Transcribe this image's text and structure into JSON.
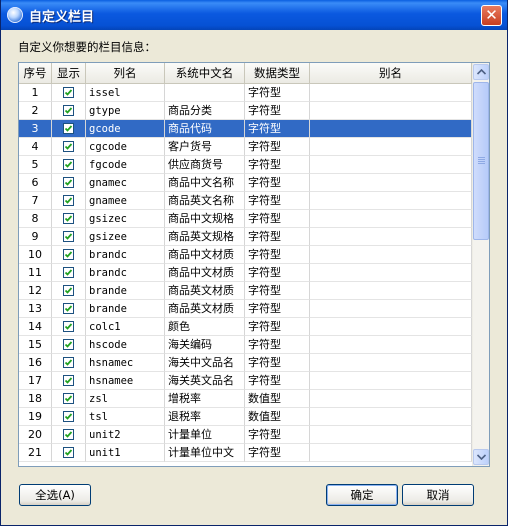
{
  "window": {
    "title": "自定义栏目",
    "close_glyph": "✕"
  },
  "prompt": "自定义你想要的栏目信息：",
  "table": {
    "headers": [
      "序号",
      "显示",
      "列名",
      "系统中文名",
      "数据类型",
      "别名"
    ],
    "selected_index": 2,
    "rows": [
      {
        "num": "1",
        "checked": true,
        "column": "issel",
        "cn_name": "",
        "dtype": "字符型",
        "alias": ""
      },
      {
        "num": "2",
        "checked": true,
        "column": "gtype",
        "cn_name": "商品分类",
        "dtype": "字符型",
        "alias": ""
      },
      {
        "num": "3",
        "checked": true,
        "column": "gcode",
        "cn_name": "商品代码",
        "dtype": "字符型",
        "alias": ""
      },
      {
        "num": "4",
        "checked": true,
        "column": "cgcode",
        "cn_name": "客户货号",
        "dtype": "字符型",
        "alias": ""
      },
      {
        "num": "5",
        "checked": true,
        "column": "fgcode",
        "cn_name": "供应商货号",
        "dtype": "字符型",
        "alias": ""
      },
      {
        "num": "6",
        "checked": true,
        "column": "gnamec",
        "cn_name": "商品中文名称",
        "dtype": "字符型",
        "alias": ""
      },
      {
        "num": "7",
        "checked": true,
        "column": "gnamee",
        "cn_name": "商品英文名称",
        "dtype": "字符型",
        "alias": ""
      },
      {
        "num": "8",
        "checked": true,
        "column": "gsizec",
        "cn_name": "商品中文规格",
        "dtype": "字符型",
        "alias": ""
      },
      {
        "num": "9",
        "checked": true,
        "column": "gsizee",
        "cn_name": "商品英文规格",
        "dtype": "字符型",
        "alias": ""
      },
      {
        "num": "10",
        "checked": true,
        "column": "brandc",
        "cn_name": "商品中文材质",
        "dtype": "字符型",
        "alias": ""
      },
      {
        "num": "11",
        "checked": true,
        "column": "brandc",
        "cn_name": "商品中文材质",
        "dtype": "字符型",
        "alias": ""
      },
      {
        "num": "12",
        "checked": true,
        "column": "brande",
        "cn_name": "商品英文材质",
        "dtype": "字符型",
        "alias": ""
      },
      {
        "num": "13",
        "checked": true,
        "column": "brande",
        "cn_name": "商品英文材质",
        "dtype": "字符型",
        "alias": ""
      },
      {
        "num": "14",
        "checked": true,
        "column": "colc1",
        "cn_name": "颜色",
        "dtype": "字符型",
        "alias": ""
      },
      {
        "num": "15",
        "checked": true,
        "column": "hscode",
        "cn_name": "海关编码",
        "dtype": "字符型",
        "alias": ""
      },
      {
        "num": "16",
        "checked": true,
        "column": "hsnamec",
        "cn_name": "海关中文品名",
        "dtype": "字符型",
        "alias": ""
      },
      {
        "num": "17",
        "checked": true,
        "column": "hsnamee",
        "cn_name": "海关英文品名",
        "dtype": "字符型",
        "alias": ""
      },
      {
        "num": "18",
        "checked": true,
        "column": "zsl",
        "cn_name": "增税率",
        "dtype": "数值型",
        "alias": ""
      },
      {
        "num": "19",
        "checked": true,
        "column": "tsl",
        "cn_name": "退税率",
        "dtype": "数值型",
        "alias": ""
      },
      {
        "num": "20",
        "checked": true,
        "column": "unit2",
        "cn_name": "计量单位",
        "dtype": "字符型",
        "alias": ""
      },
      {
        "num": "21",
        "checked": true,
        "column": "unit1",
        "cn_name": "计量单位中文",
        "dtype": "字符型",
        "alias": ""
      }
    ]
  },
  "buttons": {
    "select_all": "全选(A)",
    "ok": "确定",
    "cancel": "取消"
  },
  "colors": {
    "title_bar": "#0b59e0",
    "selection": "#316ac5",
    "dialog_bg": "#ece9d8",
    "checkmark": "#21a121"
  }
}
